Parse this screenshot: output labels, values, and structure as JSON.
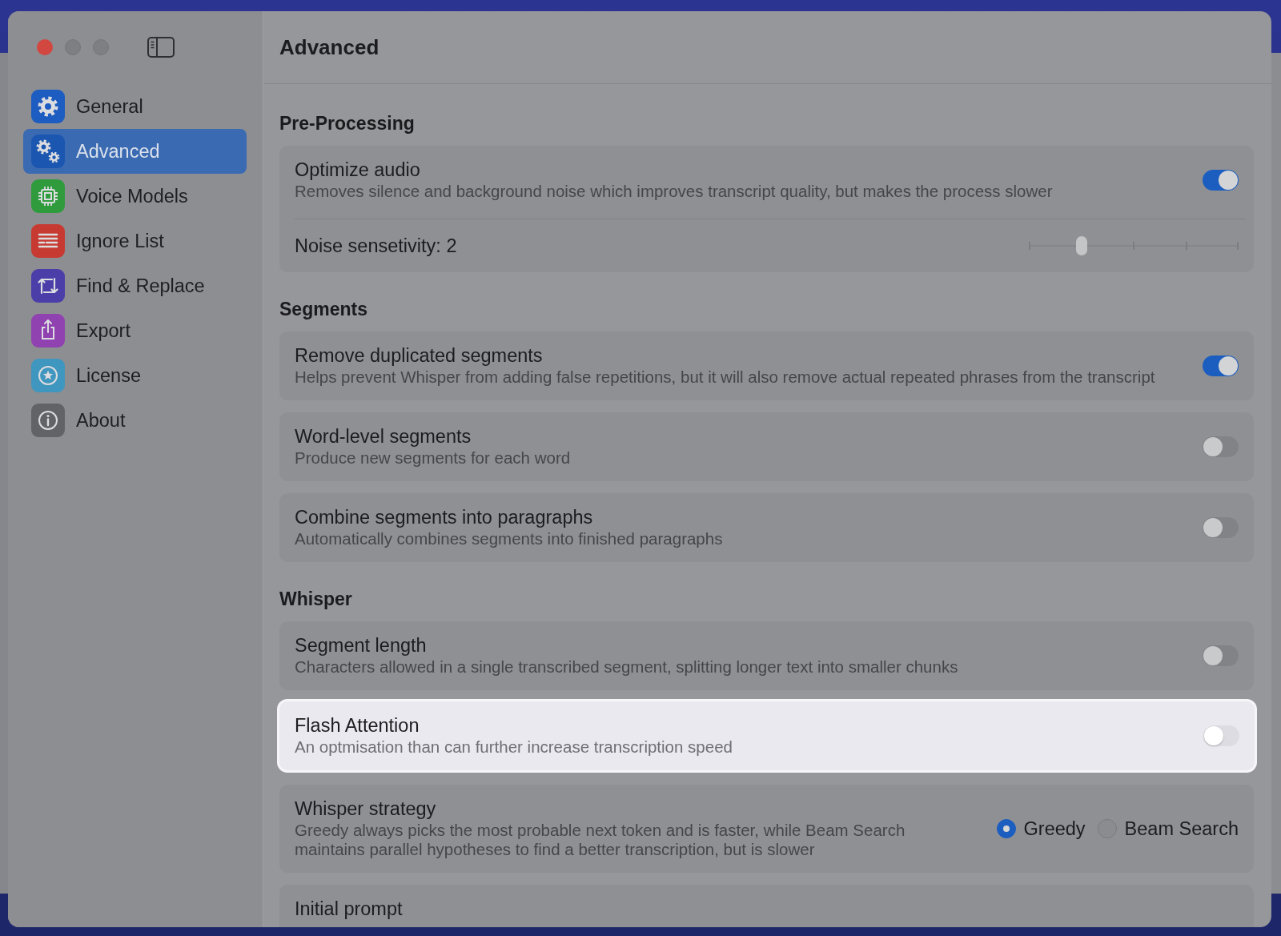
{
  "window": {
    "title": "Advanced",
    "controls": [
      {
        "kind": "close",
        "disabled": false
      },
      {
        "kind": "minimize",
        "disabled": true
      },
      {
        "kind": "zoom",
        "disabled": true
      }
    ]
  },
  "sidebar": {
    "items": [
      {
        "label": "General",
        "color": "#1d5cc0",
        "selected": false
      },
      {
        "label": "Advanced",
        "color": "#1b56b0",
        "selected": true
      },
      {
        "label": "Voice Models",
        "color": "#2f9b3d",
        "selected": false
      },
      {
        "label": "Ignore List",
        "color": "#c73a31",
        "selected": false
      },
      {
        "label": "Find & Replace",
        "color": "#4b3ea8",
        "selected": false
      },
      {
        "label": "Export",
        "color": "#8f42b0",
        "selected": false
      },
      {
        "label": "License",
        "color": "#3f96be",
        "selected": false
      },
      {
        "label": "About",
        "color": "#626367",
        "selected": false
      }
    ]
  },
  "sections": [
    {
      "heading": "Pre-Processing",
      "cards": [
        {
          "highlighted": false,
          "rows": [
            {
              "kind": "toggle",
              "title": "Optimize audio",
              "description": "Removes silence and background noise which improves transcript quality, but makes the process slower",
              "on": true
            },
            {
              "kind": "slider",
              "label": "Noise sensetivity: 2",
              "level": 0.25
            }
          ]
        }
      ]
    },
    {
      "heading": "Segments",
      "cards": [
        {
          "highlighted": false,
          "rows": [
            {
              "kind": "toggle",
              "title": "Remove duplicated segments",
              "description": "Helps prevent Whisper from adding false repetitions, but it will also remove actual repeated phrases from the transcript",
              "on": true
            }
          ]
        },
        {
          "highlighted": false,
          "rows": [
            {
              "kind": "toggle",
              "title": "Word-level segments",
              "description": "Produce new segments for each word",
              "on": false
            }
          ]
        },
        {
          "highlighted": false,
          "rows": [
            {
              "kind": "toggle",
              "title": "Combine segments into paragraphs",
              "description": "Automatically combines segments into finished paragraphs",
              "on": false
            }
          ]
        }
      ]
    },
    {
      "heading": "Whisper",
      "cards": [
        {
          "highlighted": false,
          "rows": [
            {
              "kind": "toggle",
              "title": "Segment length",
              "description": "Characters allowed in a single transcribed segment, splitting longer text into smaller chunks",
              "on": false
            }
          ]
        },
        {
          "highlighted": true,
          "rows": [
            {
              "kind": "toggle",
              "title": "Flash Attention",
              "description": "An optmisation than can further increase transcription speed",
              "on": false
            }
          ]
        },
        {
          "highlighted": false,
          "rows": [
            {
              "kind": "radio",
              "title": "Whisper strategy",
              "description": "Greedy always picks the most probable next token and is faster, while Beam Search maintains parallel hypotheses to find a better transcription, but is slower",
              "options": [
                {
                  "label": "Greedy",
                  "selected": true
                },
                {
                  "label": "Beam Search",
                  "selected": false
                }
              ]
            }
          ]
        },
        {
          "highlighted": false,
          "rows": [
            {
              "kind": "text",
              "title": "Initial prompt"
            }
          ]
        }
      ]
    }
  ]
}
